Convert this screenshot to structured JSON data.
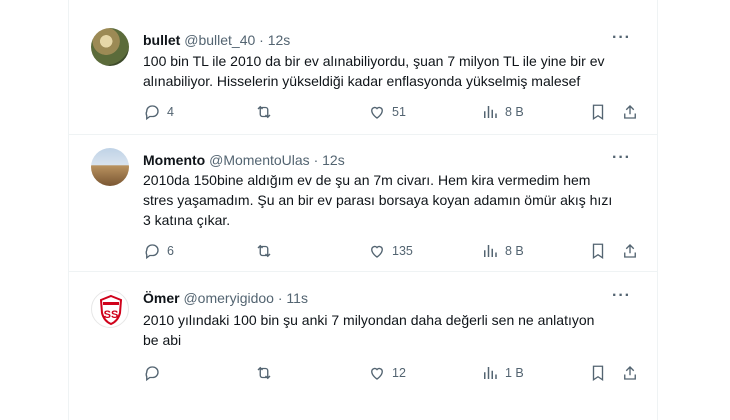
{
  "tweets": [
    {
      "name": "bullet",
      "handle": "@bullet_40",
      "time": "12s",
      "text_lines": [
        "100 bin TL ile 2010 da bir ev alınabiliyordu, şuan 7 milyon TL ile yine bir ev",
        "alınabiliyor. Hisselerin yükseldiği kadar enflasyonda yükselmiş malesef"
      ],
      "replies": "4",
      "retweets": "",
      "likes": "51",
      "views": "8 B"
    },
    {
      "name": "Momento",
      "handle": "@MomentoUlas",
      "time": "12s",
      "text_lines": [
        "2010da 150bine aldığım ev de şu an 7m civarı. Hem kira vermedim hem",
        "stres yaşamadım. Şu an bir ev parası borsaya koyan adamın ömür akış hızı",
        "3 katına çıkar."
      ],
      "replies": "6",
      "retweets": "",
      "likes": "135",
      "views": "8 B"
    },
    {
      "name": "Ömer",
      "handle": "@omeryigidoo",
      "time": "11s",
      "text_lines": [
        "2010 yılındaki 100 bin şu anki 7 milyondan daha değerli sen ne anlatıyon",
        "be abi"
      ],
      "replies": "",
      "retweets": "",
      "likes": "12",
      "views": "1 B"
    }
  ],
  "icons": {
    "reply": "reply-icon",
    "retweet": "retweet-icon",
    "like": "like-icon",
    "views": "views-icon",
    "bookmark": "bookmark-icon",
    "share": "share-icon",
    "more": "more-icon"
  },
  "colors": {
    "text": "#0f1419",
    "secondary": "#536471",
    "divider": "#eff3f4",
    "logo_red": "#d0021b"
  }
}
